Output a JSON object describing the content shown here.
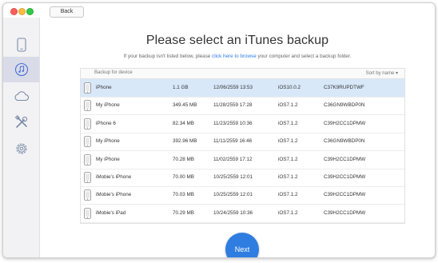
{
  "window": {
    "back_label": "Back"
  },
  "sidebar": {
    "items": [
      {
        "icon": "phone-icon",
        "active": false
      },
      {
        "icon": "music-note-icon",
        "active": true
      },
      {
        "icon": "cloud-icon",
        "active": false
      },
      {
        "icon": "tools-icon",
        "active": false
      },
      {
        "icon": "gear-icon",
        "active": false
      }
    ]
  },
  "main": {
    "title": "Please select an iTunes backup",
    "subtitle_before": "If your backup isn't listed below, please ",
    "subtitle_link": "click here to browse",
    "subtitle_after": " your computer and select a backup folder."
  },
  "table": {
    "header_left": "Backup for device",
    "sort_label": "Sort by name ▾",
    "rows": [
      {
        "name": "iPhone",
        "size": "1.1 GB",
        "date": "12/06/2559 13:53",
        "ios": "iOS10.0.2",
        "serial": "C37K9RUPDTWF",
        "selected": true
      },
      {
        "name": "My iPhone",
        "size": "349.45 MB",
        "date": "11/28/2559 17:28",
        "ios": "iOS7.1.2",
        "serial": "C36GN9WBDP0N",
        "selected": false
      },
      {
        "name": "iPhone 6",
        "size": "82.34 MB",
        "date": "11/23/2559 10:36",
        "ios": "iOS7.1.2",
        "serial": "C39H2CC1DPMW",
        "selected": false
      },
      {
        "name": "My iPhone",
        "size": "392.96 MB",
        "date": "11/11/2559 16:46",
        "ios": "iOS7.1.2",
        "serial": "C36GN9WBDP0N",
        "selected": false
      },
      {
        "name": "My iPhone",
        "size": "70.28 MB",
        "date": "11/02/2559 17:12",
        "ios": "iOS7.1.2",
        "serial": "C39H2CC1DPMW",
        "selected": false
      },
      {
        "name": "iMobie's iPhone",
        "size": "70.00 MB",
        "date": "10/25/2559 12:01",
        "ios": "iOS7.1.2",
        "serial": "C39H2CC1DPMW",
        "selected": false
      },
      {
        "name": "iMobie's iPhone",
        "size": "70.03 MB",
        "date": "10/25/2559 12:01",
        "ios": "iOS7.1.2",
        "serial": "C39H2CC1DPMW",
        "selected": false
      },
      {
        "name": "iMobie's iPad",
        "size": "70.29 MB",
        "date": "10/24/2559 10:36",
        "ios": "iOS7.1.2",
        "serial": "C39H2CC1DPMW",
        "selected": false
      }
    ]
  },
  "actions": {
    "next_label": "Next"
  },
  "colors": {
    "accent": "#2f7de1",
    "selected_row": "#d8e8f9",
    "sidebar_bg": "#f2f2f4"
  }
}
